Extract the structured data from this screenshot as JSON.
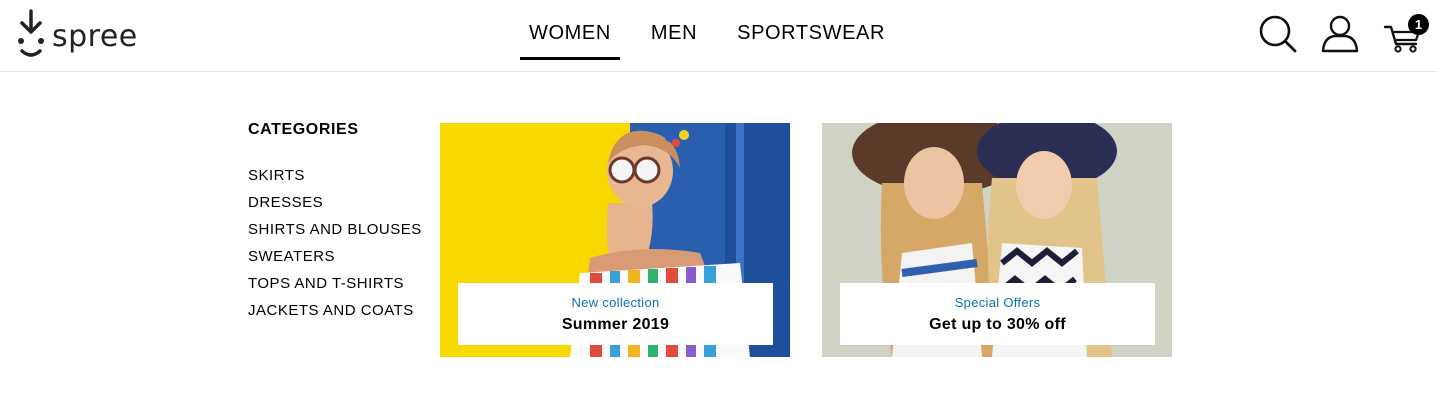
{
  "brand": {
    "name": "spree"
  },
  "nav": {
    "items": [
      "WOMEN",
      "MEN",
      "SPORTSWEAR"
    ],
    "active": 0
  },
  "header_icons": [
    "search-icon",
    "account-icon",
    "cart-icon"
  ],
  "cart": {
    "count": "1"
  },
  "menu": {
    "title": "CATEGORIES",
    "items": [
      "SKIRTS",
      "DRESSES",
      "SHIRTS AND BLOUSES",
      "SWEATERS",
      "TOPS AND T-SHIRTS",
      "JACKETS AND COATS"
    ]
  },
  "promos": [
    {
      "subtitle": "New collection",
      "title": "Summer 2019"
    },
    {
      "subtitle": "Special Offers",
      "title": "Get up to 30% off"
    }
  ],
  "colors": {
    "accent_blue": "#0a6fb5",
    "promo1_yellow": "#f7d900",
    "promo1_blue": "#2a5fb0",
    "promo2_bg": "#cfd3c4"
  }
}
